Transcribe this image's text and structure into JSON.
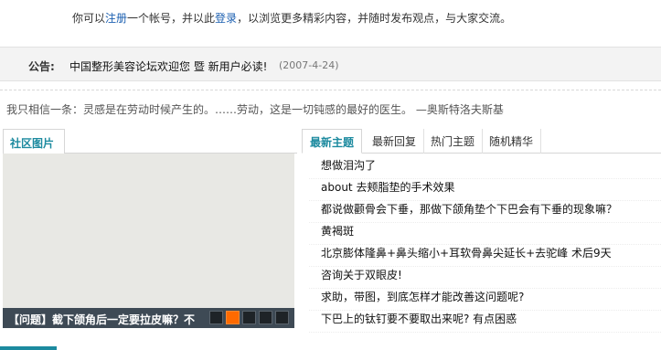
{
  "register_note": {
    "prefix": "你可以",
    "register_link": "注册",
    "middle": "一个帐号，并以此",
    "login_link": "登录",
    "suffix": "，以浏览更多精彩内容，并随时发布观点，与大家交流。"
  },
  "announcement": {
    "label": "公告:",
    "text": "中国整形美容论坛欢迎您 暨 新用户必读!",
    "date": "(2007-4-24)"
  },
  "quote": "我只相信一条：灵感是在劳动时候产生的。……劳动，这是一切钝感的最好的医生。 —奥斯特洛夫斯基",
  "community_photos": {
    "tab_label": "社区图片",
    "caption": "【问题】截下颌角后一定要拉皮嘛？不",
    "slides": [
      {
        "active": false
      },
      {
        "active": true
      },
      {
        "active": false
      },
      {
        "active": false
      },
      {
        "active": false
      }
    ]
  },
  "topics": {
    "tabs": [
      {
        "label": "最新主题",
        "active": true
      },
      {
        "label": "最新回复",
        "active": false
      },
      {
        "label": "热门主题",
        "active": false
      },
      {
        "label": "随机精华",
        "active": false
      }
    ],
    "items": [
      "想做泪沟了",
      "about 去颊脂垫的手术效果",
      "都说做颧骨会下垂，那做下颌角垫个下巴会有下垂的现象嘛？",
      "黄褐斑",
      "北京膨体隆鼻+鼻头缩小+耳软骨鼻尖延长+去驼峰 术后9天",
      "咨询关于双眼皮!",
      "求助，带图，到底怎样才能改善这问题呢?",
      "下巴上的钛钉要不要取出来呢? 有点困惑"
    ]
  },
  "colors": {
    "accent": "#1c8a9f",
    "link": "#1b5fb0",
    "active_slide": "#ff6a00"
  }
}
